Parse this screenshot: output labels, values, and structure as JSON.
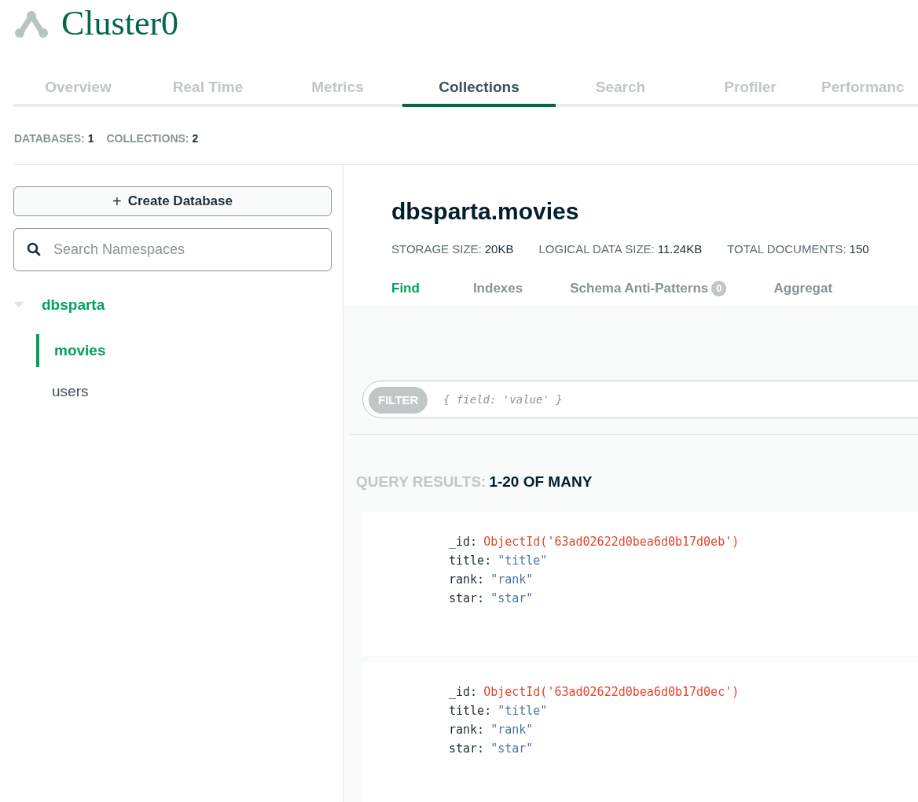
{
  "cluster": {
    "title": "Cluster0"
  },
  "tabs": [
    {
      "label": "Overview",
      "selected": false
    },
    {
      "label": "Real Time",
      "selected": false
    },
    {
      "label": "Metrics",
      "selected": false
    },
    {
      "label": "Collections",
      "selected": true
    },
    {
      "label": "Search",
      "selected": false
    },
    {
      "label": "Profiler",
      "selected": false
    },
    {
      "label": "Performanc",
      "selected": false
    }
  ],
  "summary": [
    {
      "label": "DATABASES:",
      "value": "1"
    },
    {
      "label": "COLLECTIONS:",
      "value": "2"
    }
  ],
  "sidebar": {
    "create_button": "Create Database",
    "create_icon": "+",
    "search": {
      "placeholder": "Search Namespaces"
    },
    "databases": [
      {
        "name": "dbsparta",
        "expanded": true,
        "children": [
          {
            "name": "movies",
            "selected": true
          },
          {
            "name": "users",
            "selected": false
          }
        ]
      }
    ]
  },
  "collection": {
    "title": "dbsparta.movies",
    "stats": [
      {
        "label": "STORAGE SIZE:",
        "value": "20KB"
      },
      {
        "label": "LOGICAL DATA SIZE:",
        "value": "11.24KB"
      },
      {
        "label": "TOTAL DOCUMENTS:",
        "value": "150"
      }
    ],
    "tabs": [
      {
        "label": "Find",
        "selected": true
      },
      {
        "label": "Indexes",
        "selected": false
      },
      {
        "label": "Schema Anti-Patterns",
        "badge": "0",
        "selected": false
      },
      {
        "label": "Aggregat",
        "selected": false
      }
    ],
    "filter": {
      "label": "FILTER",
      "placeholder": "{ field: 'value' }"
    },
    "results": {
      "label": "QUERY RESULTS:",
      "value": "1-20 OF MANY"
    },
    "documents": [
      {
        "fields": [
          {
            "key": "_id:",
            "value": "ObjectId('63ad02622d0bea6d0b17d0eb')",
            "kind": "objectid"
          },
          {
            "key": "title:",
            "value": "\"title\"",
            "kind": "string"
          },
          {
            "key": "rank:",
            "value": "\"rank\"",
            "kind": "string"
          },
          {
            "key": "star:",
            "value": "\"star\"",
            "kind": "string"
          }
        ]
      },
      {
        "fields": [
          {
            "key": "_id:",
            "value": "ObjectId('63ad02622d0bea6d0b17d0ec')",
            "kind": "objectid"
          },
          {
            "key": "title:",
            "value": "\"title\"",
            "kind": "string"
          },
          {
            "key": "rank:",
            "value": "\"rank\"",
            "kind": "string"
          },
          {
            "key": "star:",
            "value": "\"star\"",
            "kind": "string"
          }
        ]
      }
    ]
  }
}
